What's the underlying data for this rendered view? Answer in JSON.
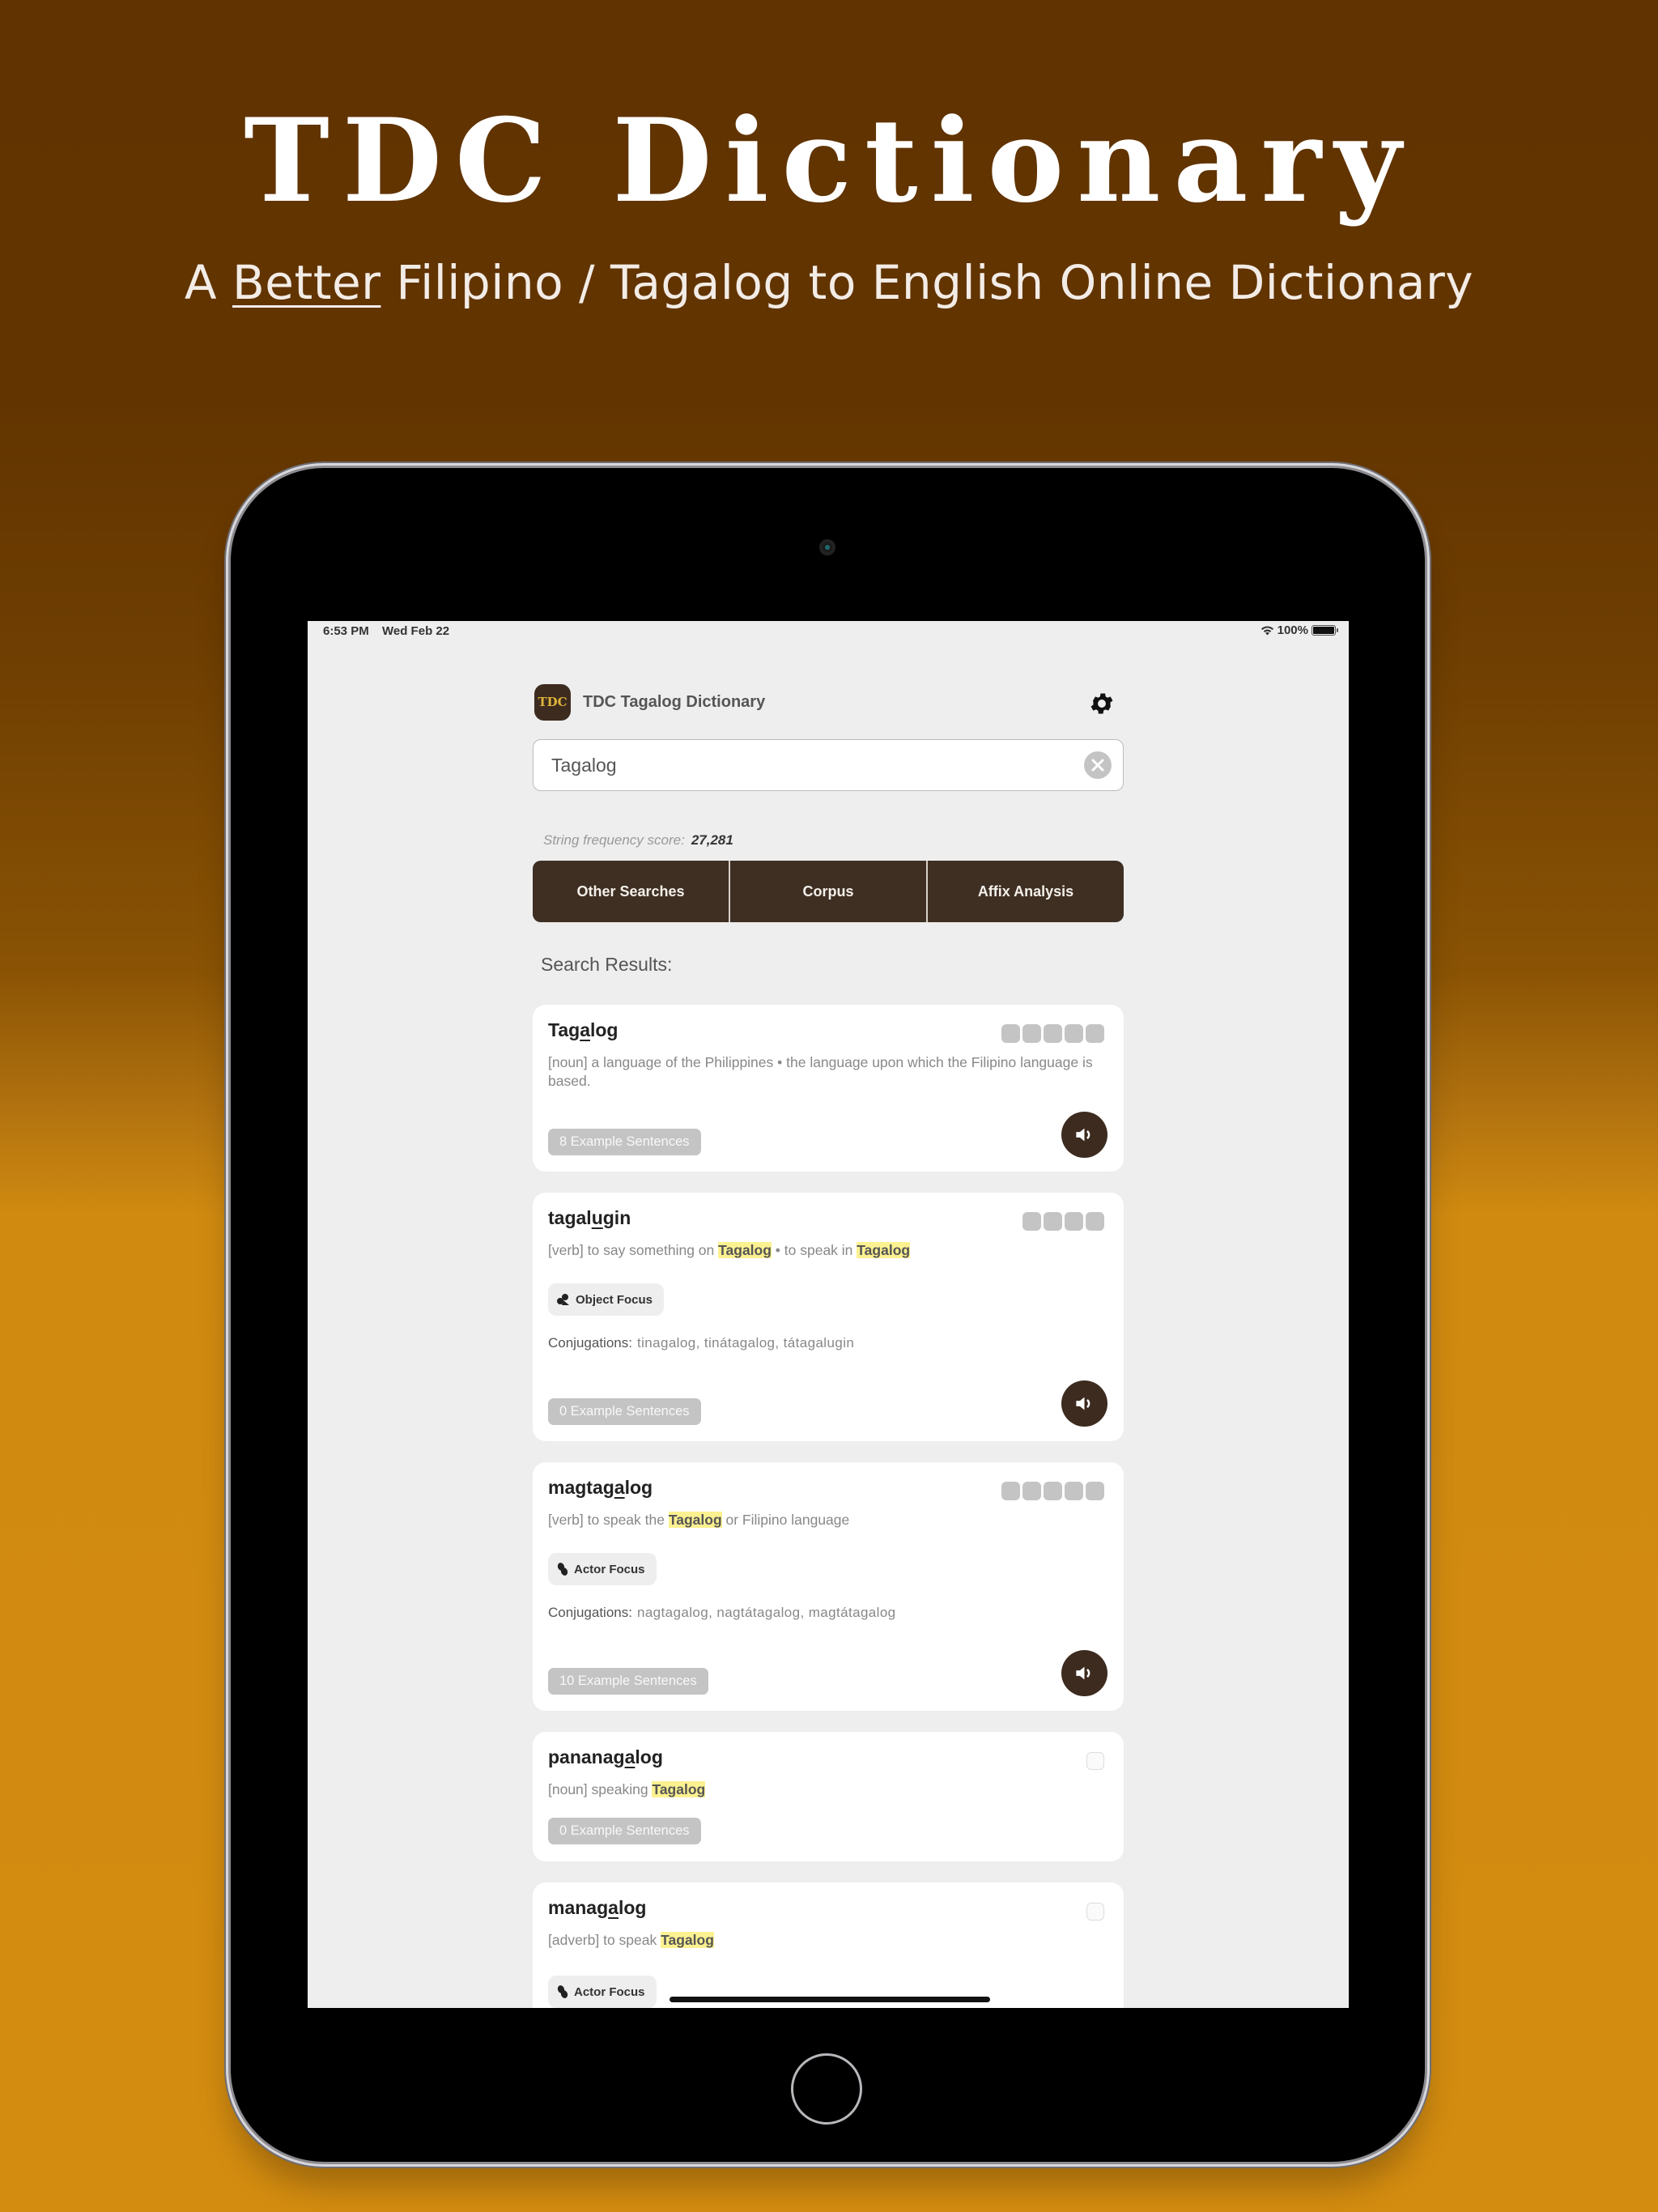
{
  "hero": {
    "title": "TDC Dictionary",
    "subtitle_prefix": "A ",
    "subtitle_emphasis": "Better",
    "subtitle_suffix": " Filipino / Tagalog to English Online Dictionary"
  },
  "status_bar": {
    "time": "6:53 PM",
    "date": "Wed Feb 22",
    "battery": "100%",
    "battery_level": 1.0
  },
  "app": {
    "logo_text": "TDC",
    "title": "TDC Tagalog Dictionary",
    "search": {
      "value": "Tagalog",
      "placeholder": ""
    },
    "frequency": {
      "label": "String frequency score:",
      "value": "27,281"
    },
    "tabs": [
      {
        "label": "Other Searches"
      },
      {
        "label": "Corpus"
      },
      {
        "label": "Affix Analysis"
      }
    ],
    "results_label": "Search Results:",
    "results": [
      {
        "word_pre": "Tag",
        "word_accent": "a",
        "word_post": "log",
        "definition": "[noun] a language of the Philippines • the language upon which the Filipino language is based.",
        "frequency_bars": 5,
        "examples": "8 Example Sentences"
      },
      {
        "word_pre": "tagal",
        "word_accent": "u",
        "word_post": "gin",
        "def_parts": [
          "[verb] to say something on ",
          "Tagalog",
          " • to speak in ",
          "Tagalog"
        ],
        "frequency_bars": 4,
        "focus": "Object Focus",
        "conj_label": "Conjugations:",
        "conjugations": "tinagalog, tinátagalog, tátagalugin",
        "examples": "0 Example Sentences"
      },
      {
        "word_pre": "magtag",
        "word_accent": "a",
        "word_post": "log",
        "def_parts": [
          "[verb] to speak the ",
          "Tagalog",
          " or Filipino language"
        ],
        "frequency_bars": 5,
        "focus": "Actor Focus",
        "conj_label": "Conjugations:",
        "conjugations": "nagtagalog, nagtátagalog, magtátagalog",
        "examples": "10 Example Sentences"
      },
      {
        "word_pre": "pananag",
        "word_accent": "a",
        "word_post": "log",
        "def_parts": [
          "[noun] speaking ",
          "Tagalog"
        ],
        "frequency_bars": 0,
        "examples": "0 Example Sentences"
      },
      {
        "word_pre": "manag",
        "word_accent": "a",
        "word_post": "log",
        "def_parts": [
          "[adverb] to speak ",
          "Tagalog"
        ],
        "frequency_bars": 0,
        "focus": "Actor Focus"
      }
    ]
  },
  "colors": {
    "bg_top": "#603300",
    "bg_bottom": "#d48c10",
    "app_brown": "#3f2f23",
    "highlight": "#fcf190",
    "screen_bg": "#eeeeee"
  }
}
